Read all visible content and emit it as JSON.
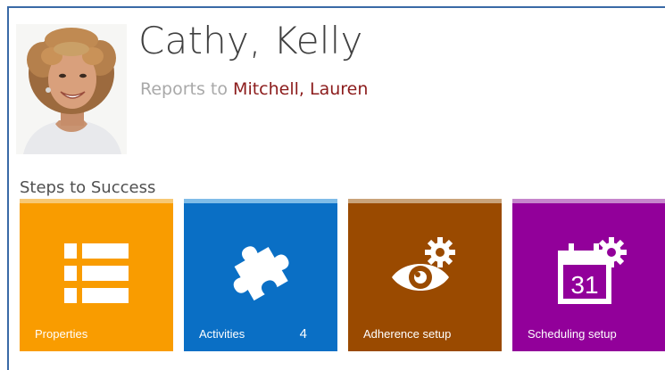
{
  "profile": {
    "name": "Cathy, Kelly",
    "reports_prefix": "Reports to",
    "manager": "Mitchell, Lauren"
  },
  "section": {
    "title": "Steps to Success"
  },
  "tiles": [
    {
      "label": "Properties",
      "icon": "list-icon",
      "color": "#f99c00",
      "cap_color": "#f7c874"
    },
    {
      "label": "Activities",
      "count": "4",
      "icon": "puzzle-icon",
      "color": "#0a6fc5",
      "cap_color": "#7fbce8"
    },
    {
      "label": "Adherence setup",
      "icon": "eye-gear-icon",
      "color": "#9a4a00",
      "cap_color": "#c9a37a"
    },
    {
      "label": "Scheduling setup",
      "icon": "calendar-gear-icon",
      "color": "#92009a",
      "cap_color": "#c685cc",
      "calendar_day": "31"
    }
  ]
}
